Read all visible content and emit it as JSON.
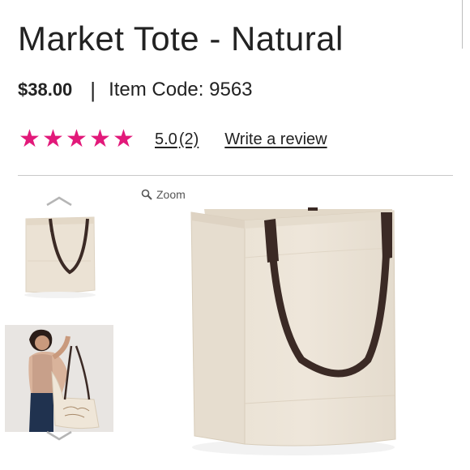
{
  "product": {
    "title": "Market Tote - Natural",
    "price": "$38.00",
    "separator": "|",
    "item_code_label": "Item Code: 9563"
  },
  "reviews": {
    "rating": "5.0",
    "count": "(2)",
    "stars_filled": 5,
    "stars_total": 5,
    "write_review_label": "Write a review"
  },
  "gallery": {
    "zoom_label": "Zoom",
    "thumb_up_icon": "chevron-up-icon",
    "thumb_down_icon": "chevron-down-icon",
    "zoom_icon": "search-icon"
  },
  "colors": {
    "star": "#e2197a",
    "canvas": "#ece3d5",
    "strap": "#3b2a25"
  }
}
